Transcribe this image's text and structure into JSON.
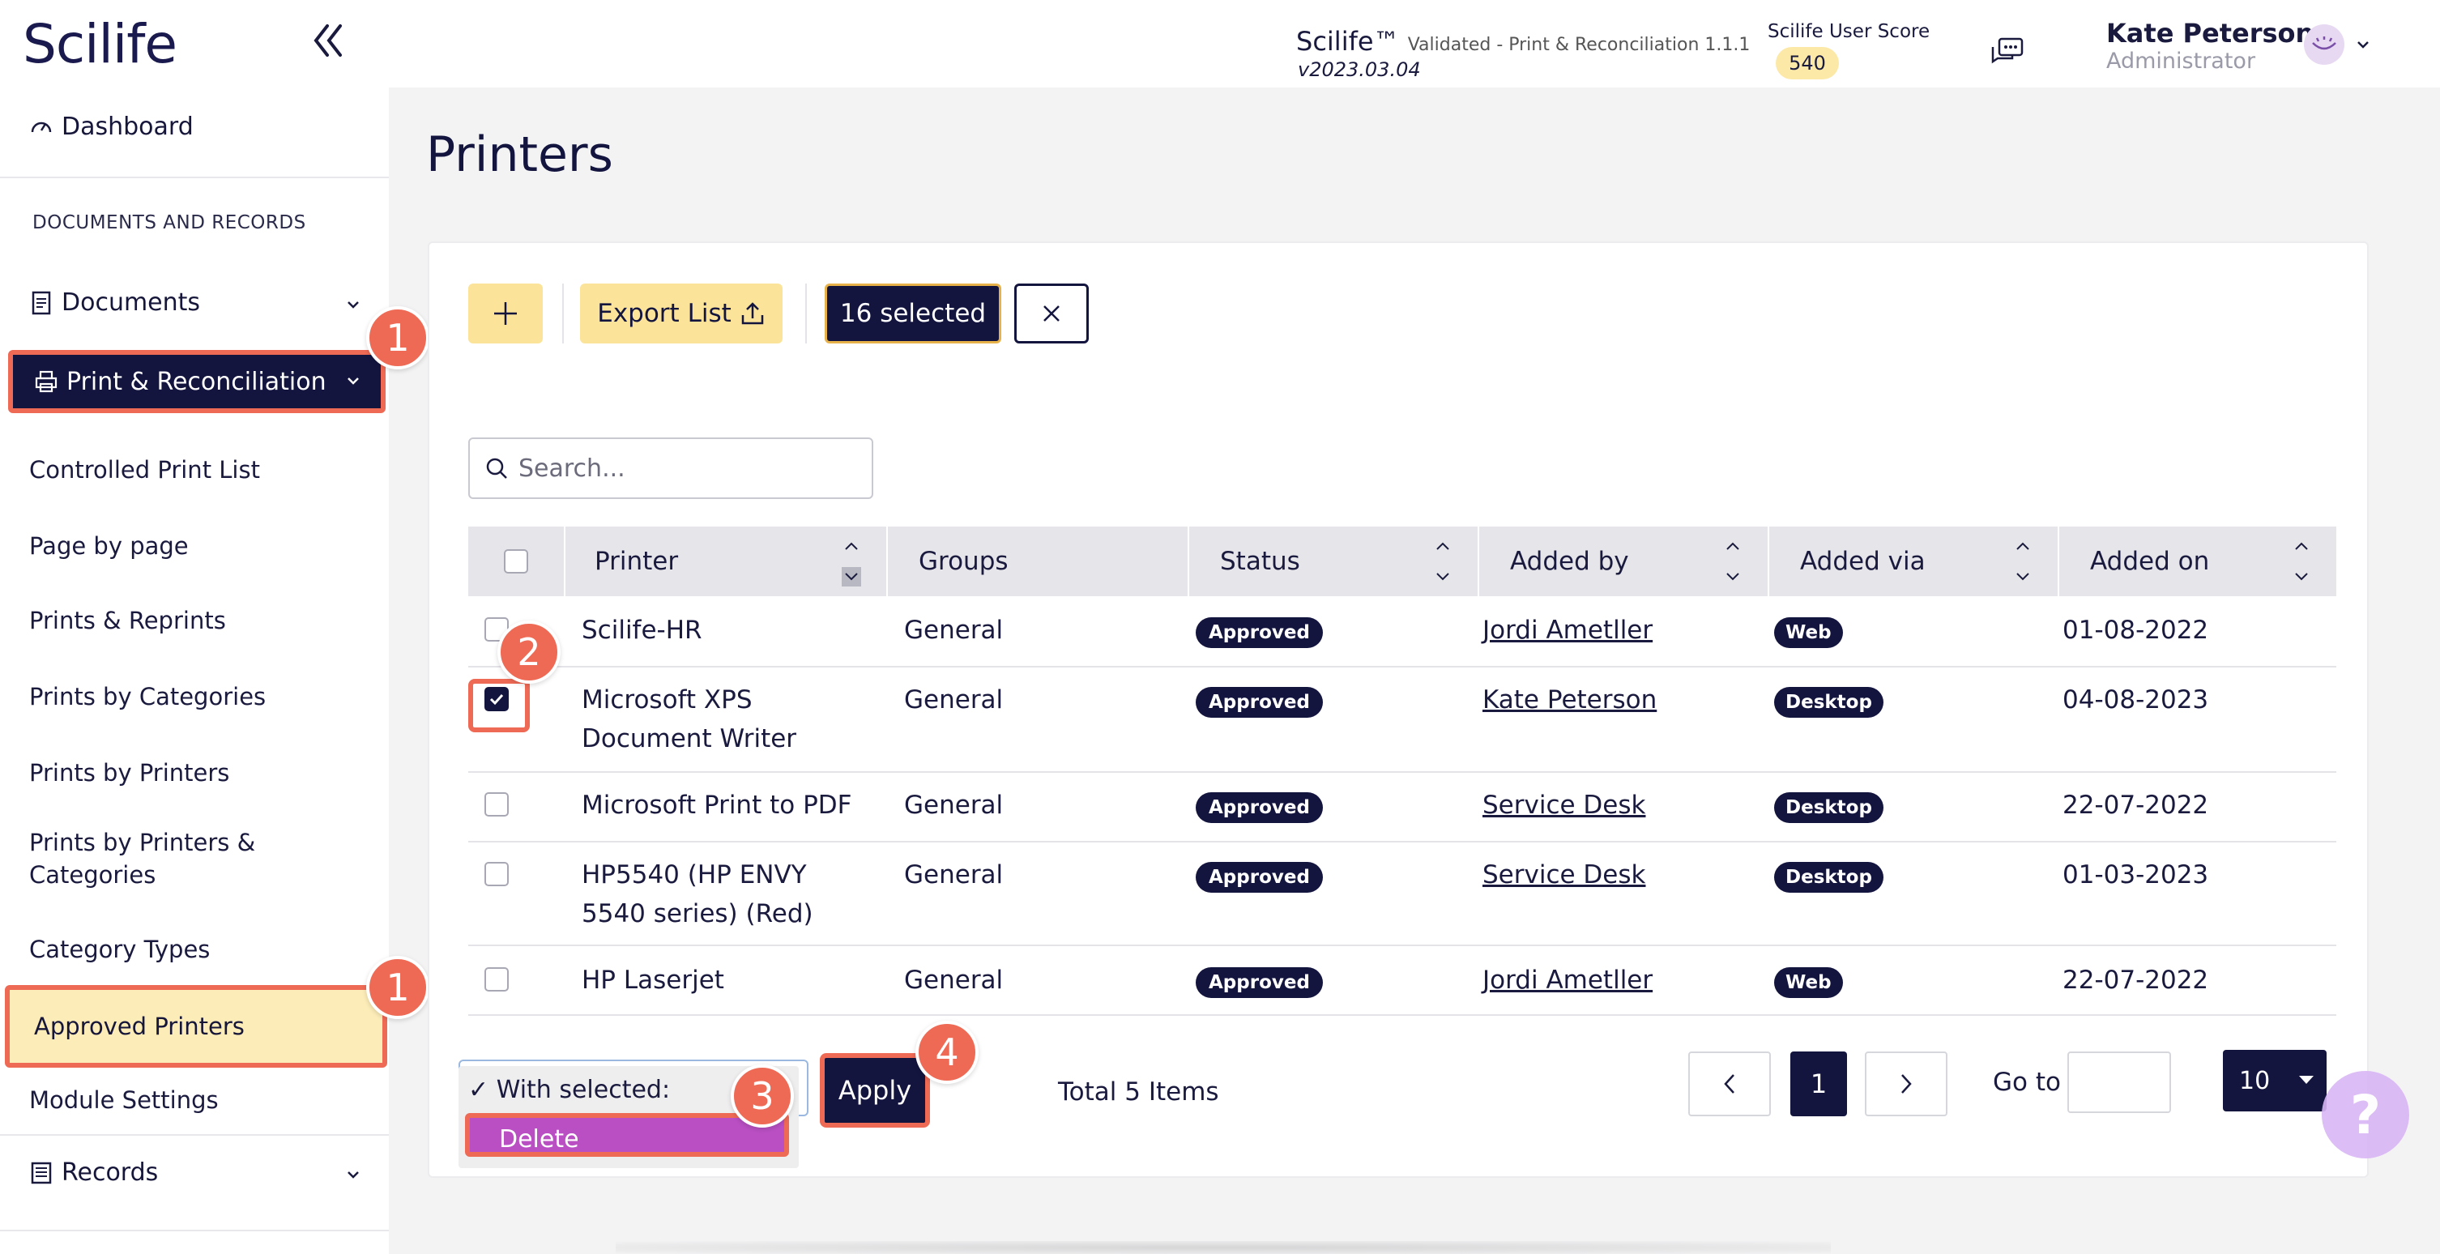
{
  "app": {
    "logo": "Scilife",
    "product_name": "Scilife™",
    "product_subtitle": "Validated - Print & Reconciliation 1.1.1",
    "version": "v2023.03.04",
    "score_label": "Scilife User Score",
    "score_value": "540",
    "user_name": "Kate Peterson",
    "user_role": "Administrator"
  },
  "sidebar": {
    "dashboard": "Dashboard",
    "section_label": "DOCUMENTS AND RECORDS",
    "documents": "Documents",
    "print_reconciliation": "Print & Reconciliation",
    "items": [
      "Controlled Print List",
      "Page by page",
      "Prints & Reprints",
      "Prints by Categories",
      "Prints by Printers",
      "Prints by Printers & Categories",
      "Category Types",
      "Approved Printers",
      "Module Settings"
    ],
    "records": "Records"
  },
  "page": {
    "title": "Printers"
  },
  "toolbar": {
    "add_icon": "plus-icon",
    "export_label": "Export List",
    "selected_label": "16 selected"
  },
  "search": {
    "placeholder": "Search..."
  },
  "table": {
    "headers": [
      "Printer",
      "Groups",
      "Status",
      "Added by",
      "Added via",
      "Added on"
    ],
    "rows": [
      {
        "printer": "Scilife-HR",
        "groups": "General",
        "status": "Approved",
        "added_by": "Jordi Ametller",
        "added_via": "Web",
        "added_on": "01-08-2022",
        "checked": false
      },
      {
        "printer": "Microsoft XPS Document Writer",
        "groups": "General",
        "status": "Approved",
        "added_by": "Kate Peterson",
        "added_via": "Desktop",
        "added_on": "04-08-2023",
        "checked": true
      },
      {
        "printer": "Microsoft Print to PDF",
        "groups": "General",
        "status": "Approved",
        "added_by": "Service Desk",
        "added_via": "Desktop",
        "added_on": "22-07-2022",
        "checked": false
      },
      {
        "printer": "HP5540 (HP ENVY 5540 series) (Red)",
        "groups": "General",
        "status": "Approved",
        "added_by": "Service Desk",
        "added_via": "Desktop",
        "added_on": "01-03-2023",
        "checked": false
      },
      {
        "printer": "HP Laserjet",
        "groups": "General",
        "status": "Approved",
        "added_by": "Jordi Ametller",
        "added_via": "Web",
        "added_on": "22-07-2022",
        "checked": false
      }
    ]
  },
  "bulk": {
    "option_with_selected": "With selected:",
    "option_delete": "Delete",
    "apply_label": "Apply"
  },
  "pagination": {
    "total": "Total 5 Items",
    "current_page": "1",
    "goto_label": "Go to",
    "page_size": "10"
  },
  "help": {
    "label": "?"
  },
  "steps": [
    "1",
    "1",
    "2",
    "3",
    "4"
  ],
  "colors": {
    "navy": "#13153f",
    "accent_yellow": "#fbe49a",
    "highlight_red": "#ee6a55",
    "delete_purple": "#b94fc3"
  }
}
